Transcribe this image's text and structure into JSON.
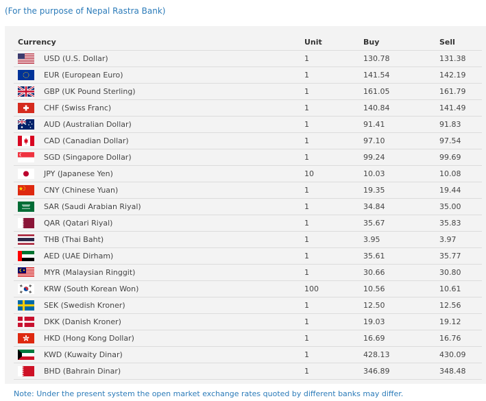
{
  "subtitle": "(For the purpose of Nepal Rastra Bank)",
  "table": {
    "headers": {
      "currency": "Currency",
      "unit": "Unit",
      "buy": "Buy",
      "sell": "Sell"
    },
    "rows": [
      {
        "currency": "USD (U.S. Dollar)",
        "unit": "1",
        "buy": "130.78",
        "sell": "131.38",
        "flag": "us-flag-icon"
      },
      {
        "currency": "EUR (European Euro)",
        "unit": "1",
        "buy": "141.54",
        "sell": "142.19",
        "flag": "eu-flag-icon"
      },
      {
        "currency": "GBP (UK Pound Sterling)",
        "unit": "1",
        "buy": "161.05",
        "sell": "161.79",
        "flag": "gb-flag-icon"
      },
      {
        "currency": "CHF (Swiss Franc)",
        "unit": "1",
        "buy": "140.84",
        "sell": "141.49",
        "flag": "ch-flag-icon"
      },
      {
        "currency": "AUD (Australian Dollar)",
        "unit": "1",
        "buy": "91.41",
        "sell": "91.83",
        "flag": "au-flag-icon"
      },
      {
        "currency": "CAD (Canadian Dollar)",
        "unit": "1",
        "buy": "97.10",
        "sell": "97.54",
        "flag": "ca-flag-icon"
      },
      {
        "currency": "SGD (Singapore Dollar)",
        "unit": "1",
        "buy": "99.24",
        "sell": "99.69",
        "flag": "sg-flag-icon"
      },
      {
        "currency": "JPY (Japanese Yen)",
        "unit": "10",
        "buy": "10.03",
        "sell": "10.08",
        "flag": "jp-flag-icon"
      },
      {
        "currency": "CNY (Chinese Yuan)",
        "unit": "1",
        "buy": "19.35",
        "sell": "19.44",
        "flag": "cn-flag-icon"
      },
      {
        "currency": "SAR (Saudi Arabian Riyal)",
        "unit": "1",
        "buy": "34.84",
        "sell": "35.00",
        "flag": "sa-flag-icon"
      },
      {
        "currency": "QAR (Qatari Riyal)",
        "unit": "1",
        "buy": "35.67",
        "sell": "35.83",
        "flag": "qa-flag-icon"
      },
      {
        "currency": "THB (Thai Baht)",
        "unit": "1",
        "buy": "3.95",
        "sell": "3.97",
        "flag": "th-flag-icon"
      },
      {
        "currency": "AED (UAE Dirham)",
        "unit": "1",
        "buy": "35.61",
        "sell": "35.77",
        "flag": "ae-flag-icon"
      },
      {
        "currency": "MYR (Malaysian Ringgit)",
        "unit": "1",
        "buy": "30.66",
        "sell": "30.80",
        "flag": "my-flag-icon"
      },
      {
        "currency": "KRW (South Korean Won)",
        "unit": "100",
        "buy": "10.56",
        "sell": "10.61",
        "flag": "kr-flag-icon"
      },
      {
        "currency": "SEK (Swedish Kroner)",
        "unit": "1",
        "buy": "12.50",
        "sell": "12.56",
        "flag": "se-flag-icon"
      },
      {
        "currency": "DKK (Danish Kroner)",
        "unit": "1",
        "buy": "19.03",
        "sell": "19.12",
        "flag": "dk-flag-icon"
      },
      {
        "currency": "HKD (Hong Kong Dollar)",
        "unit": "1",
        "buy": "16.69",
        "sell": "16.76",
        "flag": "hk-flag-icon"
      },
      {
        "currency": "KWD (Kuwaity Dinar)",
        "unit": "1",
        "buy": "428.13",
        "sell": "430.09",
        "flag": "kw-flag-icon"
      },
      {
        "currency": "BHD (Bahrain Dinar)",
        "unit": "1",
        "buy": "346.89",
        "sell": "348.48",
        "flag": "bh-flag-icon"
      }
    ]
  },
  "note": "Note: Under the present system the open market exchange rates quoted by different banks may differ.",
  "colors": {
    "link_blue": "#2b7bb9",
    "panel_bg": "#f3f3f3",
    "row_border": "#dcdcdc"
  }
}
